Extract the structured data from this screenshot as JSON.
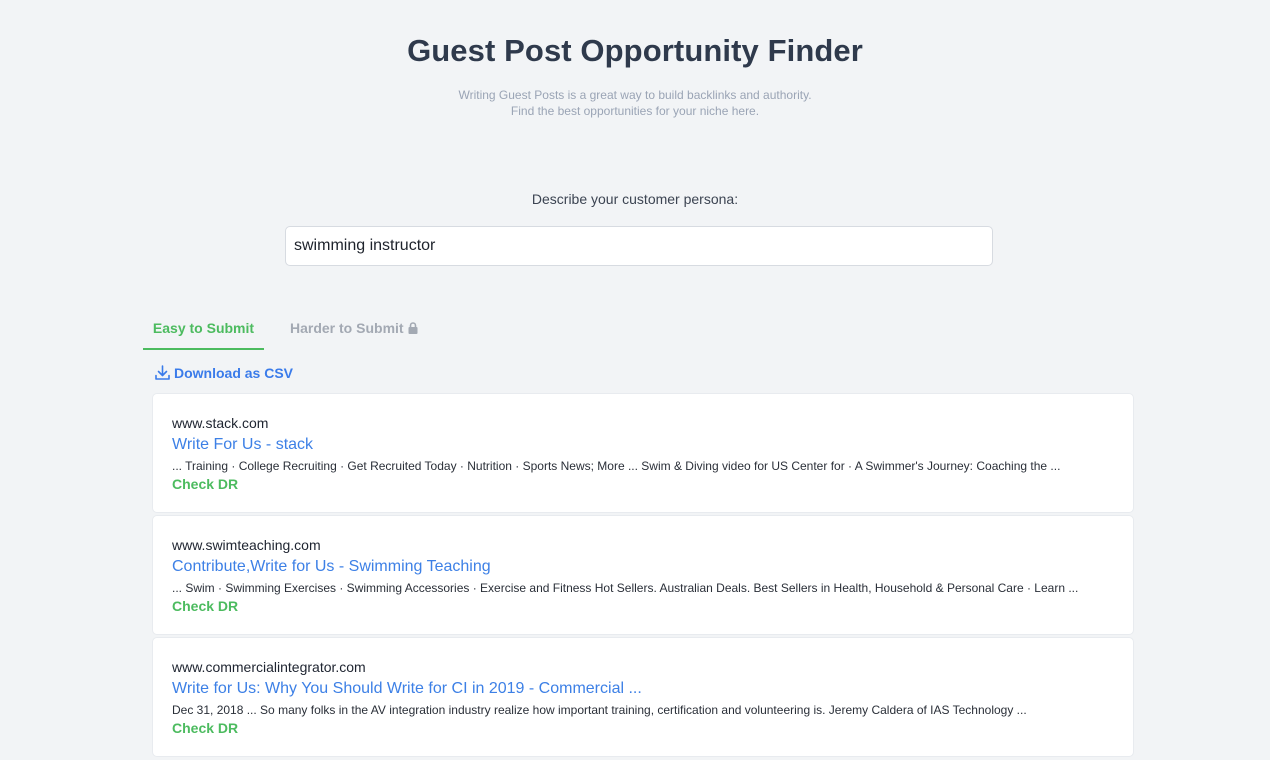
{
  "header": {
    "title": "Guest Post Opportunity Finder",
    "subtitle_line1": "Writing Guest Posts is a great way to build backlinks and authority.",
    "subtitle_line2": "Find the best opportunities for your niche here."
  },
  "persona": {
    "label": "Describe your customer persona:",
    "value": "swimming instructor"
  },
  "tabs": [
    {
      "label": "Easy to Submit",
      "active": true
    },
    {
      "label": "Harder to Submit",
      "active": false,
      "icon": "lock-icon"
    }
  ],
  "download": {
    "label": "Download as CSV",
    "icon": "download-icon"
  },
  "results": [
    {
      "domain": "www.stack.com",
      "title": "Write For Us - stack",
      "snippet": "... Training · College Recruiting · Get Recruited Today · Nutrition · Sports News; More ... Swim & Diving video for US Center for · A Swimmer's Journey: Coaching the ...",
      "check": "Check DR"
    },
    {
      "domain": "www.swimteaching.com",
      "title": "Contribute,Write for Us - Swimming Teaching",
      "snippet": "... Swim · Swimming Exercises · Swimming Accessories · Exercise and Fitness Hot Sellers. Australian Deals. Best Sellers in Health, Household & Personal Care · Learn ...",
      "check": "Check DR"
    },
    {
      "domain": "www.commercialintegrator.com",
      "title": "Write for Us: Why You Should Write for CI in 2019 - Commercial ...",
      "snippet": "Dec 31, 2018 ... So many folks in the AV integration industry realize how important training, certification and volunteering is. Jeremy Caldera of IAS Technology ...",
      "check": "Check DR"
    }
  ],
  "colors": {
    "background": "#f2f4f6",
    "title": "#2f3a4c",
    "accent_green": "#4cbb5f",
    "link_blue": "#3d80e6",
    "muted": "#a3a9b3"
  }
}
